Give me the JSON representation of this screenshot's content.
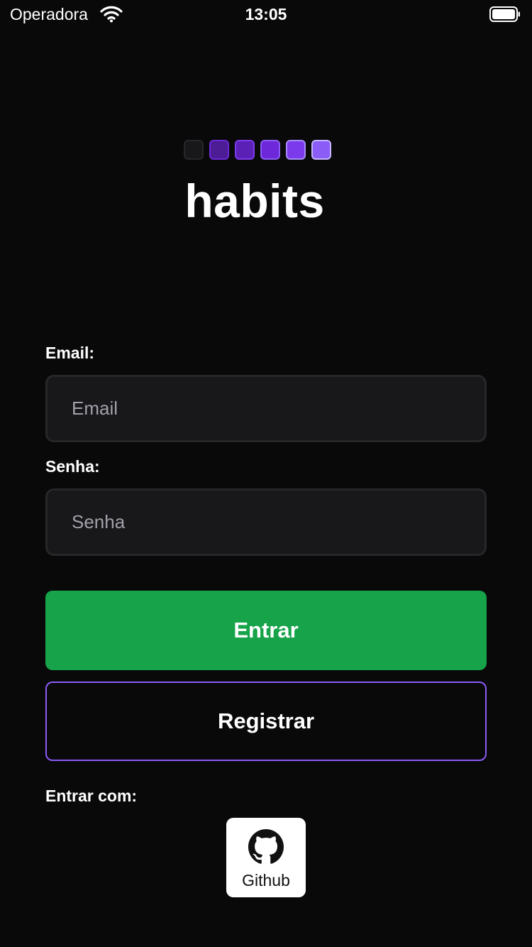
{
  "status_bar": {
    "carrier": "Operadora",
    "time": "13:05",
    "icons": [
      "wifi-icon",
      "battery-icon"
    ]
  },
  "logo": {
    "title": "habits",
    "squares": [
      {
        "fill": "#18181b",
        "border": "#27272a"
      },
      {
        "fill": "#4c1d95",
        "border": "#6d28d9"
      },
      {
        "fill": "#5b21b6",
        "border": "#7c3aed"
      },
      {
        "fill": "#6d28d9",
        "border": "#8b5cf6"
      },
      {
        "fill": "#7c3aed",
        "border": "#a78bfa"
      },
      {
        "fill": "#8b5cf6",
        "border": "#c4b5fd"
      }
    ]
  },
  "form": {
    "email_label": "Email:",
    "email_placeholder": "Email",
    "email_value": "",
    "password_label": "Senha:",
    "password_placeholder": "Senha",
    "password_value": ""
  },
  "actions": {
    "login_label": "Entrar",
    "register_label": "Registrar"
  },
  "social": {
    "heading": "Entrar com:",
    "github_label": "Github",
    "github_icon": "github-icon"
  },
  "colors": {
    "background": "#09090a",
    "primary": "#16a34a",
    "accent": "#8b5cf6",
    "field_bg": "#18181b",
    "field_border": "#27272a"
  }
}
